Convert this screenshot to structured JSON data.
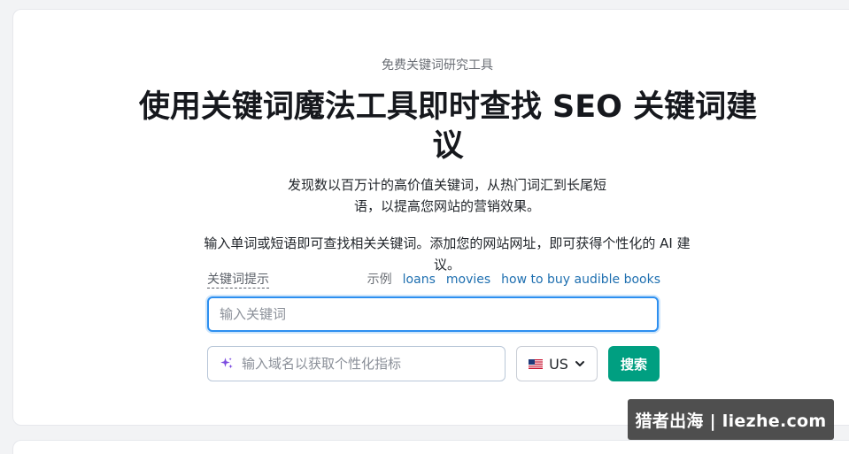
{
  "hero": {
    "eyebrow": "免费关键词研究工具",
    "title": "使用关键词魔法工具即时查找 SEO 关键词建议",
    "desc_line1": "发现数以百万计的高价值关键词，从热门词汇到长尾短语，以提高您网站的营销效果。",
    "desc_line2": "输入单词或短语即可查找相关关键词。添加您的网站网址，即可获得个性化的 AI 建议。"
  },
  "form": {
    "hint_label": "关键词提示",
    "examples_label": "示例",
    "examples": [
      "loans",
      "movies",
      "how to buy audible books"
    ],
    "keyword_placeholder": "输入关键词",
    "keyword_value": "",
    "domain_placeholder": "输入域名以获取个性化指标",
    "country": {
      "flag_icon": "us-flag-icon",
      "value": "US"
    },
    "search_label": "搜索"
  },
  "watermark": {
    "text": "猎者出海 | liezhe.com"
  },
  "colors": {
    "accent": "#009f81",
    "link": "#1e6fb0",
    "focus_border": "#2d8ff0",
    "sparkle": "#7c4ce0"
  }
}
